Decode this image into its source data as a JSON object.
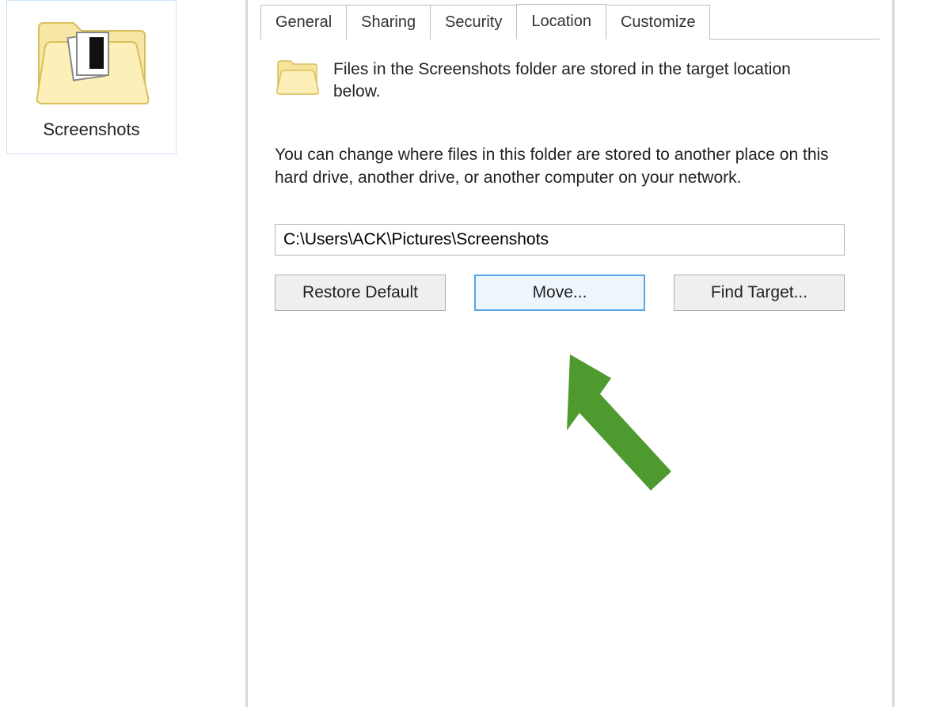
{
  "folder": {
    "label": "Screenshots"
  },
  "dialog": {
    "tabs": [
      {
        "label": "General",
        "active": false
      },
      {
        "label": "Sharing",
        "active": false
      },
      {
        "label": "Security",
        "active": false
      },
      {
        "label": "Location",
        "active": true
      },
      {
        "label": "Customize",
        "active": false
      }
    ],
    "intro_text": "Files in the Screenshots folder are stored in the target location below.",
    "explain_text": "You can change where files in this folder are stored to another place on this hard drive, another drive, or another computer on your network.",
    "path_value": "C:\\Users\\ACK\\Pictures\\Screenshots",
    "buttons": {
      "restore": "Restore Default",
      "move": "Move...",
      "find": "Find Target..."
    }
  },
  "annotation": {
    "arrow_color": "#4e9a2f"
  }
}
